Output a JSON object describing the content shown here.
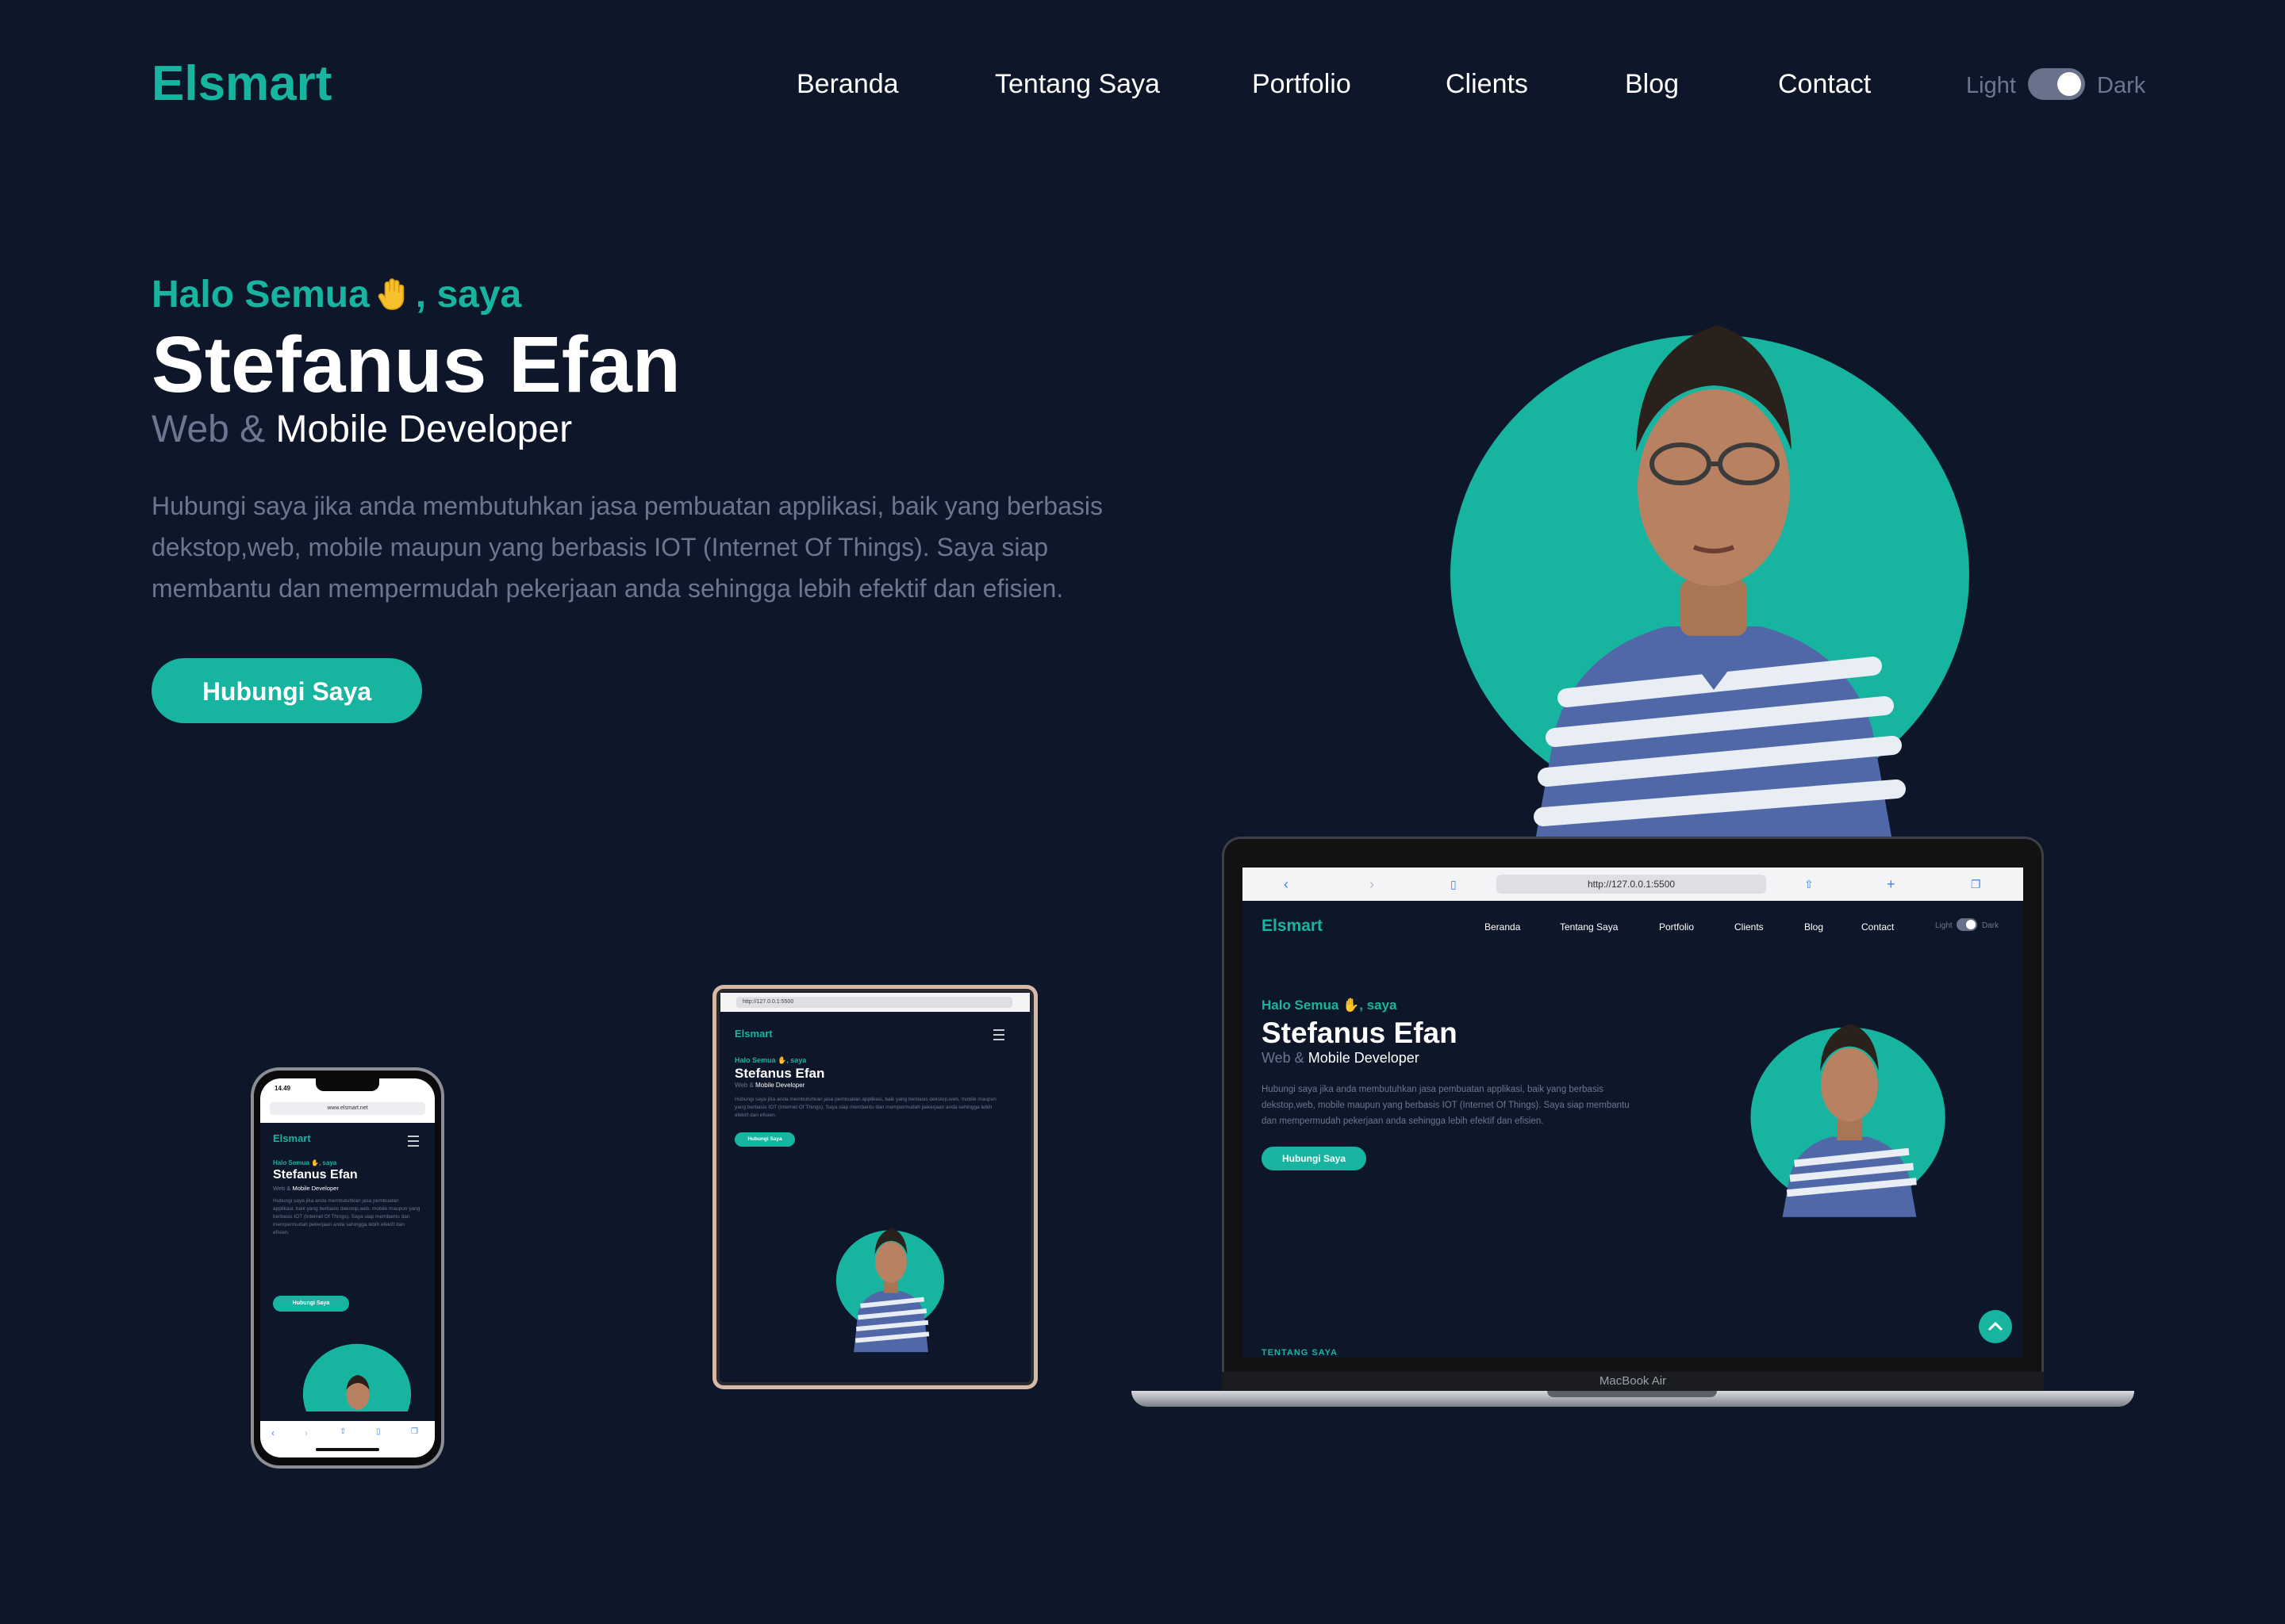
{
  "nav": {
    "logo": "Elsmart",
    "items": [
      "Beranda",
      "Tentang Saya",
      "Portfolio",
      "Clients",
      "Blog",
      "Contact"
    ],
    "theme_light": "Light",
    "theme_dark": "Dark"
  },
  "hero": {
    "greeting_prefix": "Halo Semua",
    "greeting_suffix": ", saya",
    "name": "Stefanus Efan",
    "role_muted": "Web &",
    "role_strong": "Mobile Developer",
    "description": "Hubungi saya jika anda membutuhkan jasa pembuatan applikasi, baik yang berbasis dekstop,web, mobile maupun yang berbasis IOT (Internet Of Things). Saya siap membantu dan mempermudah pekerjaan anda sehingga lebih efektif dan efisien.",
    "cta": "Hubungi Saya"
  },
  "mockups": {
    "laptop_url": "http://127.0.0.1:5500",
    "laptop_label": "MacBook Air",
    "laptop_next_section": "TENTANG SAYA",
    "tablet_url": "http://127.0.0.1:5500",
    "phone_url": "www.elsmart.net",
    "phone_time": "14.49"
  },
  "colors": {
    "background": "#0e1629",
    "accent": "#17b59f",
    "muted": "#6b7690"
  }
}
